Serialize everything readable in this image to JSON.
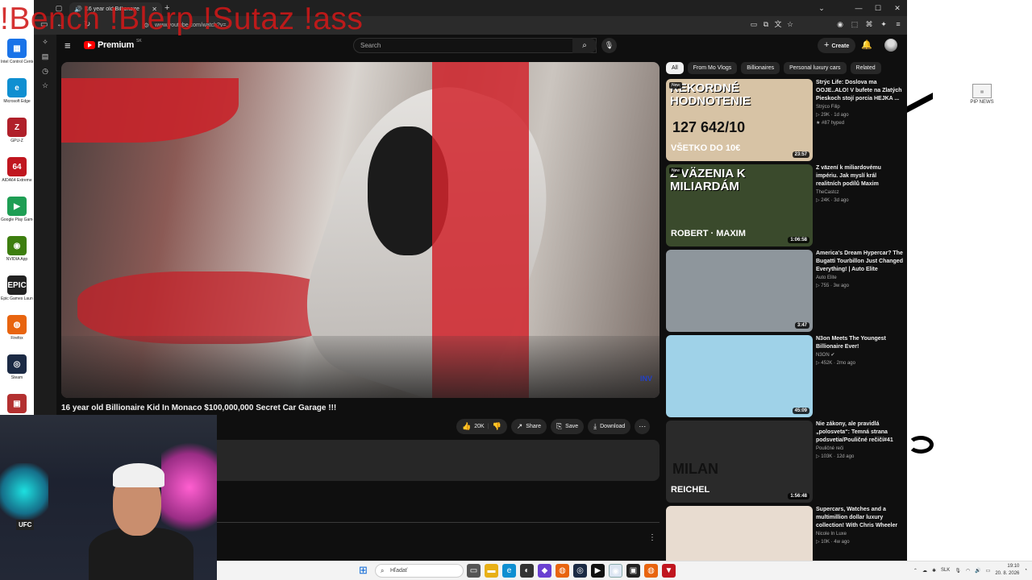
{
  "overlay_text": "!Bench !Blerp !Sutaz !ass",
  "desktop": {
    "icons": [
      {
        "label": "Intel Control Center",
        "icon": "intel-icon",
        "color": "#1a73e8",
        "glyph": "▦"
      },
      {
        "label": "Microsoft Edge",
        "icon": "edge-icon",
        "color": "#0f8fd1",
        "glyph": "e"
      },
      {
        "label": "GPU-Z",
        "icon": "gpuz-icon",
        "color": "#b0202a",
        "glyph": "Z"
      },
      {
        "label": "AIDA64 Extreme",
        "icon": "aida64-icon",
        "color": "#c0161f",
        "glyph": "64"
      },
      {
        "label": "Google Play Games",
        "icon": "play-games-icon",
        "color": "#1e9e54",
        "glyph": "▶"
      },
      {
        "label": "NVIDIA App",
        "icon": "nvidia-icon",
        "color": "#3d7e0f",
        "glyph": "◉"
      },
      {
        "label": "Epic Games Launcher",
        "icon": "epic-icon",
        "color": "#222222",
        "glyph": "EPIC"
      },
      {
        "label": "Firefox",
        "icon": "firefox-icon",
        "color": "#e8640f",
        "glyph": "◍"
      },
      {
        "label": "Steam",
        "icon": "steam-icon",
        "color": "#1b2a44",
        "glyph": "◎"
      },
      {
        "label": "",
        "icon": "app-icon",
        "color": "#b33030",
        "glyph": "▣"
      }
    ],
    "right_icon_label": "PIP NEWS"
  },
  "browser": {
    "tab_title": "16 year old Billionaire",
    "url": "www.youtube.com/watch?v=...",
    "window_controls": [
      "⌄",
      "—",
      "☐",
      "✕"
    ]
  },
  "youtube": {
    "logo_word": "Premium",
    "logo_country": "SK",
    "search_placeholder": "Search",
    "create_label": "Create",
    "video_title": "16 year old Billionaire Kid In Monaco $100,000,000 Secret Car Garage !!!",
    "watermark": "INV",
    "actions": {
      "likes": "20K",
      "share": "Share",
      "save": "Save",
      "download": "Download"
    },
    "chips": [
      "All",
      "From Mo Vlogs",
      "Billionaires",
      "Personal luxury cars",
      "Related"
    ],
    "recommendations": [
      {
        "thumb_text": "REKORDNÉ HODNOTENIE",
        "thumb_big": "127 642/10",
        "thumb_sub": "VŠETKO DO 10€",
        "thumb_bg": "#d7c3a5",
        "new": "New",
        "duration": "23:57",
        "title": "Strýc Life: Doslova ma OOJE..ALO! V bufete na Zlatých Pieskoch stojí porcia HEJKA ...",
        "channel": "Strýco Filip",
        "meta": "▷ 29K · 1d ago",
        "hype": "★ #87 hyped"
      },
      {
        "thumb_text": "Z VÄZENIA K MILIARDÁM",
        "thumb_big": "",
        "thumb_sub": "ROBERT · MAXIM",
        "thumb_bg": "#3a4a2c",
        "new": "New",
        "duration": "1:06:58",
        "title": "Z väzení k miliardovému impériu. Jak myslí král realitních podílů Maxim Ponomarenko?",
        "channel": "TheCastcz",
        "meta": "▷ 24K · 3d ago",
        "hype": ""
      },
      {
        "thumb_text": "",
        "thumb_big": "",
        "thumb_sub": "",
        "thumb_bg": "#8e969c",
        "new": "",
        "duration": "3:47",
        "title": "America's Dream Hypercar? The Bugatti Tourbillon Just Changed Everything! | Auto Elite",
        "channel": "Auto Elite",
        "meta": "▷ 755 · 3w ago",
        "hype": ""
      },
      {
        "thumb_text": "",
        "thumb_big": "",
        "thumb_sub": "",
        "thumb_bg": "#9fd2e8",
        "new": "",
        "duration": "45:09",
        "title": "N3on Meets The Youngest Billionaire Ever!",
        "channel": "N3ON ✔",
        "meta": "▷ 452K · 2mo ago",
        "hype": ""
      },
      {
        "thumb_text": "",
        "thumb_big": "MILAN",
        "thumb_sub": "REICHEL",
        "thumb_bg": "#2a2a2a",
        "new": "",
        "duration": "1:56:48",
        "title": "Nie zákony, ale pravidlá „polosveta“: Temná strana podsvetia/Pouličné rečičí#41",
        "channel": "Pouličné reči",
        "meta": "▷ 103K · 12d ago",
        "hype": ""
      },
      {
        "thumb_text": "",
        "thumb_big": "",
        "thumb_sub": "",
        "thumb_bg": "#e8dcd0",
        "new": "",
        "duration": "",
        "title": "Supercars, Watches and a multimillion dollar luxury collection! With Chris Wheeler",
        "channel": "Nicole In Luxe",
        "meta": "▷ 10K · 4w ago",
        "hype": ""
      }
    ]
  },
  "webcam": {
    "sign": "UFC"
  },
  "taskbar": {
    "search_placeholder": "Hľadať",
    "lang": "SLK",
    "time": "19:10",
    "date": "20. 8. 2026"
  }
}
